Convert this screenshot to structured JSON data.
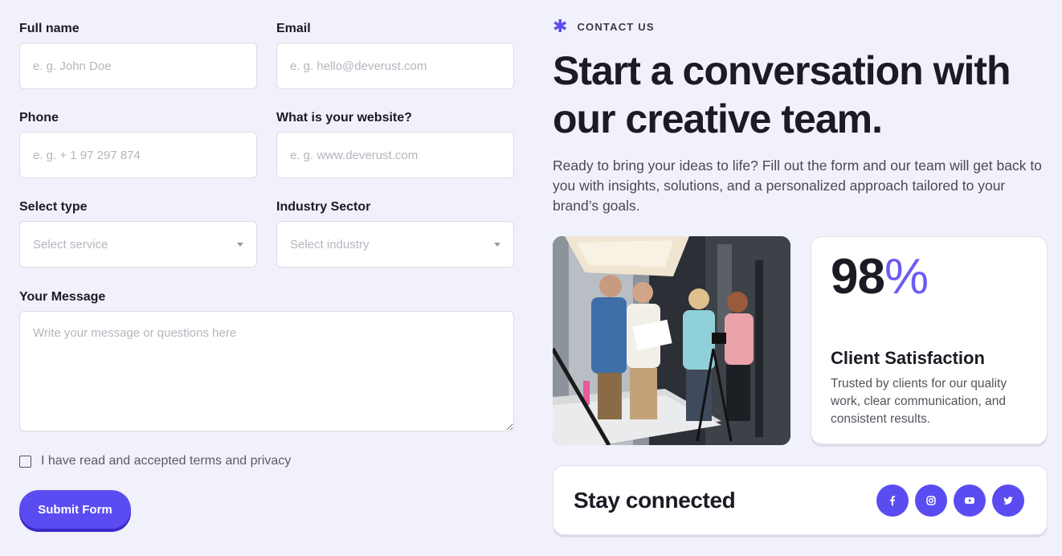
{
  "form": {
    "full_name": {
      "label": "Full name",
      "placeholder": "e. g. John Doe"
    },
    "email": {
      "label": "Email",
      "placeholder": "e. g. hello@deverust.com"
    },
    "phone": {
      "label": "Phone",
      "placeholder": "e. g. + 1 97 297 874"
    },
    "website": {
      "label": "What is your website?",
      "placeholder": "e. g. www.deverust.com"
    },
    "type": {
      "label": "Select type",
      "selected": "Select service"
    },
    "industry": {
      "label": "Industry Sector",
      "selected": "Select industry"
    },
    "message": {
      "label": "Your Message",
      "placeholder": "Write your message or questions here"
    },
    "terms_label": "I have read and accepted terms and privacy",
    "submit_label": "Submit Form"
  },
  "hero": {
    "eyebrow": "CONTACT US",
    "headline": "Start a conversation with our creative team.",
    "intro": "Ready to bring your ideas to life? Fill out the form and our team will get back to you with insights, solutions, and a personalized approach tailored to your brand’s goals."
  },
  "stat": {
    "number": "98",
    "suffix": "%",
    "title": "Client Satisfaction",
    "description": "Trusted by clients for our quality work, clear communication, and consistent results."
  },
  "connect": {
    "title": "Stay connected",
    "icons": [
      "facebook-icon",
      "instagram-icon",
      "youtube-icon",
      "twitter-icon"
    ]
  },
  "colors": {
    "accent": "#5b4cf2",
    "background": "#f1f1fb"
  }
}
